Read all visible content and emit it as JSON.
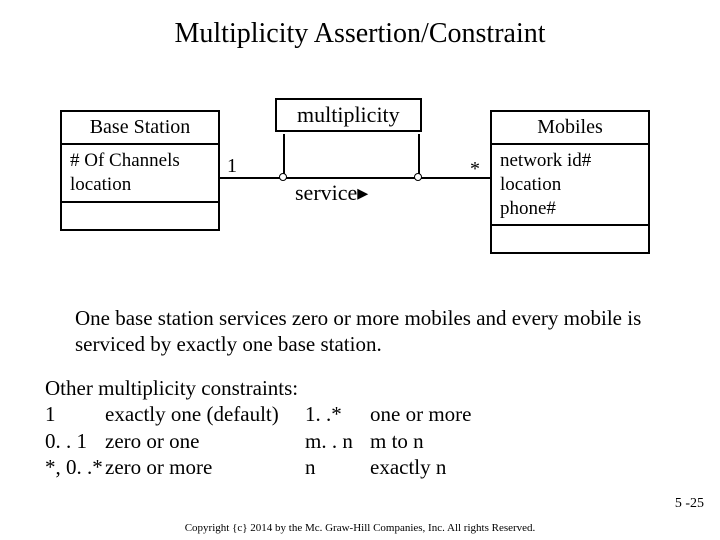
{
  "title": "Multiplicity Assertion/Constraint",
  "left_class": {
    "name": "Base Station",
    "attr1": "# Of Channels",
    "attr2": "location"
  },
  "right_class": {
    "name": "Mobiles",
    "attr1": "network id#",
    "attr2": "location",
    "attr3": "phone#"
  },
  "assoc": {
    "label_box": "multiplicity",
    "left_mult": "1",
    "right_mult": "*",
    "name": "service▸"
  },
  "caption": "One base station services zero or more mobiles and every mobile is serviced by exactly one base station.",
  "rules_heading": "Other multiplicity constraints:",
  "rules": {
    "r1s": "1",
    "r1t": "exactly one (default)",
    "r2s": "0. . 1",
    "r2t": "zero or one",
    "r3s": "*, 0. .*",
    "r3t": "zero or more",
    "r4s": "1. .*",
    "r4t": "one or more",
    "r5s": "m. . n",
    "r5t": " m to n",
    "r6s": " n",
    "r6t": "exactly n"
  },
  "page_number": "5 -25",
  "copyright": "Copyright {c} 2014 by the Mc. Graw-Hill Companies, Inc. All rights Reserved."
}
